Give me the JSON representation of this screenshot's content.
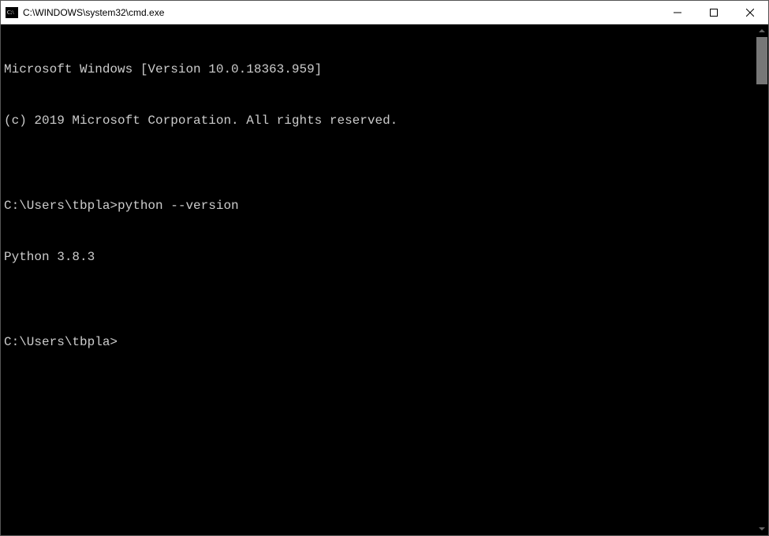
{
  "window": {
    "title": "C:\\WINDOWS\\system32\\cmd.exe"
  },
  "terminal": {
    "lines": [
      "Microsoft Windows [Version 10.0.18363.959]",
      "(c) 2019 Microsoft Corporation. All rights reserved.",
      "",
      "C:\\Users\\tbpla>python --version",
      "Python 3.8.3",
      "",
      "C:\\Users\\tbpla>"
    ]
  }
}
